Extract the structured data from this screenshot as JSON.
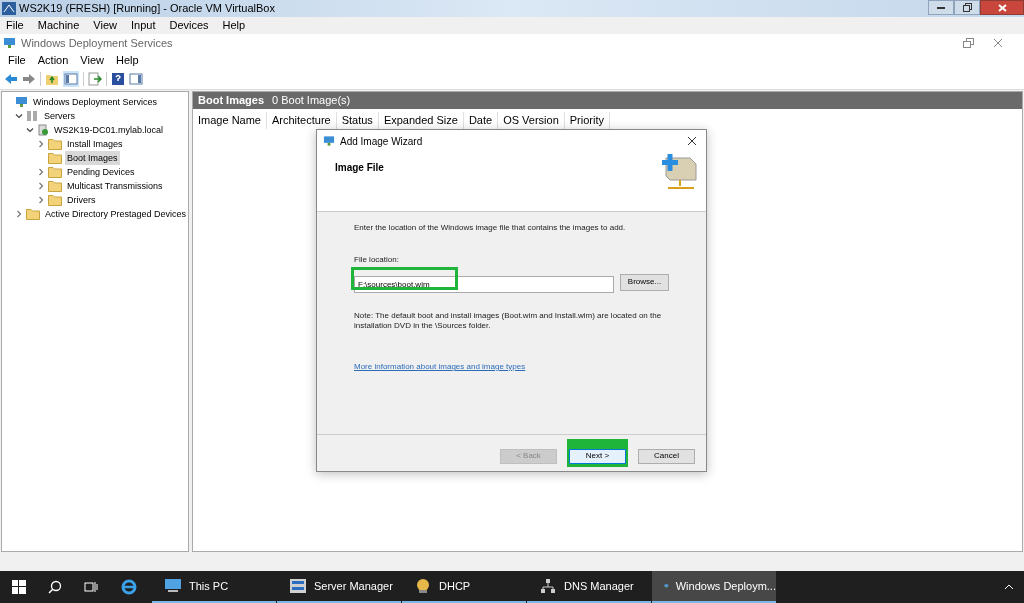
{
  "vm_window": {
    "title": "WS2K19 (FRESH) [Running] - Oracle VM VirtualBox",
    "menu": [
      "File",
      "Machine",
      "View",
      "Input",
      "Devices",
      "Help"
    ]
  },
  "app_window": {
    "title": "Windows Deployment Services",
    "menu": [
      "File",
      "Action",
      "View",
      "Help"
    ]
  },
  "tree": [
    {
      "label": "Windows Deployment Services",
      "selected": false,
      "children": [
        {
          "label": "Servers",
          "expanded": true,
          "selected": false,
          "children": [
            {
              "label": "WS2K19-DC01.mylab.local",
              "expanded": true,
              "selected": false,
              "children": [
                {
                  "label": "Install Images",
                  "expanded": false,
                  "selected": false
                },
                {
                  "label": "Boot Images",
                  "selected": true
                },
                {
                  "label": "Pending Devices",
                  "expanded": false,
                  "selected": false
                },
                {
                  "label": "Multicast Transmissions",
                  "expanded": false,
                  "selected": false
                },
                {
                  "label": "Drivers",
                  "expanded": false,
                  "selected": false
                }
              ]
            }
          ]
        },
        {
          "label": "Active Directory Prestaged Devices",
          "expanded": false,
          "selected": false
        }
      ]
    }
  ],
  "panel": {
    "title": "Boot Images",
    "count": "0 Boot Image(s)",
    "columns": [
      "Image Name",
      "Architecture",
      "Status",
      "Expanded Size",
      "Date",
      "OS Version",
      "Priority"
    ]
  },
  "dialog": {
    "title": "Add Image Wizard",
    "heading": "Image File",
    "instruction": "Enter the location of the Windows image file that contains the images to add.",
    "field_label": "File location:",
    "field_value": "F:\\sources\\boot.wim",
    "browse": "Browse...",
    "note": "Note: The default boot and install images (Boot.wim and Install.wim) are located on the installation DVD in the \\Sources folder.",
    "link": "More information about images and image types",
    "buttons": [
      {
        "label": "< Back",
        "disabled": true,
        "highlighted": false
      },
      {
        "label": "Next >",
        "disabled": false,
        "highlighted": true
      },
      {
        "label": "Cancel",
        "disabled": false,
        "highlighted": false
      }
    ]
  },
  "taskbar": [
    {
      "label": "This PC",
      "selected": false
    },
    {
      "label": "Server Manager",
      "selected": false
    },
    {
      "label": "DHCP",
      "selected": false
    },
    {
      "label": "DNS Manager",
      "selected": false
    },
    {
      "label": "Windows Deploym...",
      "selected": true
    }
  ]
}
